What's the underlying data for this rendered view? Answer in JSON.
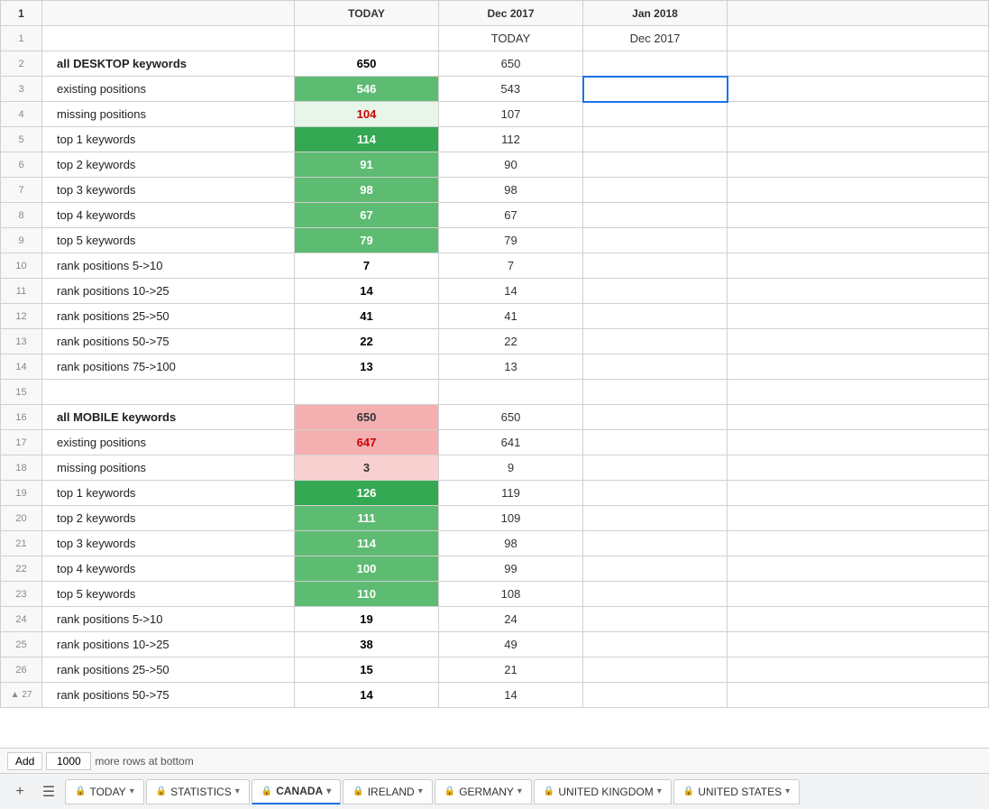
{
  "grid": {
    "columns": [
      "",
      "TODAY",
      "Dec 2017",
      "Jan 2018",
      ""
    ],
    "rows": [
      {
        "num": 1,
        "label": "",
        "today": "",
        "dec": "TODAY",
        "jan": "Dec 2017",
        "extra": "Jan 2018",
        "isHeader": true
      },
      {
        "num": 2,
        "label": "all DESKTOP keywords",
        "today": "650",
        "dec": "650",
        "jan": "",
        "labelBold": true
      },
      {
        "num": 3,
        "label": "existing positions",
        "today": "546",
        "dec": "543",
        "jan": "",
        "todayStyle": "green-med"
      },
      {
        "num": 4,
        "label": "missing positions",
        "today": "104",
        "dec": "107",
        "jan": "",
        "todayStyle": "red-text"
      },
      {
        "num": 5,
        "label": "top 1 keywords",
        "today": "114",
        "dec": "112",
        "jan": "",
        "todayStyle": "green-dark"
      },
      {
        "num": 6,
        "label": "top 2 keywords",
        "today": "91",
        "dec": "90",
        "jan": "",
        "todayStyle": "green-med"
      },
      {
        "num": 7,
        "label": "top 3 keywords",
        "today": "98",
        "dec": "98",
        "jan": "",
        "todayStyle": "green-med"
      },
      {
        "num": 8,
        "label": "top 4 keywords",
        "today": "67",
        "dec": "67",
        "jan": "",
        "todayStyle": "green-med"
      },
      {
        "num": 9,
        "label": "top 5 keywords",
        "today": "79",
        "dec": "79",
        "jan": "",
        "todayStyle": "green-med"
      },
      {
        "num": 10,
        "label": "rank positions 5->10",
        "today": "7",
        "dec": "7",
        "jan": ""
      },
      {
        "num": 11,
        "label": "rank positions 10->25",
        "today": "14",
        "dec": "14",
        "jan": ""
      },
      {
        "num": 12,
        "label": "rank positions 25->50",
        "today": "41",
        "dec": "41",
        "jan": ""
      },
      {
        "num": 13,
        "label": "rank positions 50->75",
        "today": "22",
        "dec": "22",
        "jan": ""
      },
      {
        "num": 14,
        "label": "rank positions 75->100",
        "today": "13",
        "dec": "13",
        "jan": ""
      },
      {
        "num": 15,
        "label": "",
        "today": "",
        "dec": "",
        "jan": ""
      },
      {
        "num": 16,
        "label": "all MOBILE keywords",
        "today": "650",
        "dec": "650",
        "jan": "",
        "labelBold": true,
        "todayStyle": "pink"
      },
      {
        "num": 17,
        "label": "existing positions",
        "today": "647",
        "dec": "641",
        "jan": "",
        "todayStyle": "red-text-pink"
      },
      {
        "num": 18,
        "label": "missing positions",
        "today": "3",
        "dec": "9",
        "jan": "",
        "todayStyle": "pink-light"
      },
      {
        "num": 19,
        "label": "top 1 keywords",
        "today": "126",
        "dec": "119",
        "jan": "",
        "todayStyle": "green-dark"
      },
      {
        "num": 20,
        "label": "top 2 keywords",
        "today": "111",
        "dec": "109",
        "jan": "",
        "todayStyle": "green-med"
      },
      {
        "num": 21,
        "label": "top 3 keywords",
        "today": "114",
        "dec": "98",
        "jan": "",
        "todayStyle": "green-med"
      },
      {
        "num": 22,
        "label": "top 4 keywords",
        "today": "100",
        "dec": "99",
        "jan": "",
        "todayStyle": "green-med"
      },
      {
        "num": 23,
        "label": "top 5 keywords",
        "today": "110",
        "dec": "108",
        "jan": "",
        "todayStyle": "green-med"
      },
      {
        "num": 24,
        "label": "rank positions 5->10",
        "today": "19",
        "dec": "24",
        "jan": ""
      },
      {
        "num": 25,
        "label": "rank positions 10->25",
        "today": "38",
        "dec": "49",
        "jan": ""
      },
      {
        "num": 26,
        "label": "rank positions 25->50",
        "today": "15",
        "dec": "21",
        "jan": ""
      },
      {
        "num": 27,
        "label": "rank positions 50->75",
        "today": "14",
        "dec": "14",
        "jan": ""
      }
    ]
  },
  "bottomBar": {
    "addButton": "Add",
    "rowCount": "1000",
    "moreRows": "more rows at bottom",
    "tabs": [
      {
        "label": "TODAY",
        "locked": true,
        "active": false
      },
      {
        "label": "STATISTICS",
        "locked": true,
        "active": false
      },
      {
        "label": "CANADA",
        "locked": true,
        "active": true
      },
      {
        "label": "IRELAND",
        "locked": true,
        "active": false
      },
      {
        "label": "GERMANY",
        "locked": true,
        "active": false
      },
      {
        "label": "UNITED KINGDOM",
        "locked": true,
        "active": false
      },
      {
        "label": "UNITED STATES",
        "locked": true,
        "active": false
      }
    ]
  }
}
